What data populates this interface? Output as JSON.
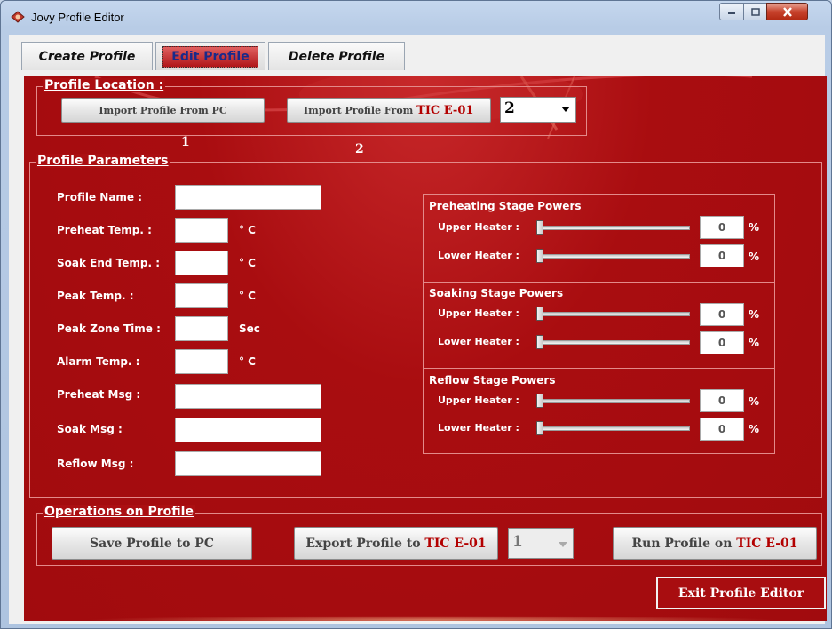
{
  "window": {
    "title": "Jovy Profile Editor"
  },
  "tabs": [
    {
      "label": "Create Profile"
    },
    {
      "label": "Edit Profile",
      "selected": true
    },
    {
      "label": "Delete Profile"
    }
  ],
  "profile_location": {
    "title": "Profile Location :",
    "import_pc_label": "Import Profile From PC",
    "import_tic_prefix": "Import Profile From ",
    "device_name": "TIC E-01",
    "slot_value": "2",
    "marker_1": "1",
    "marker_2": "2"
  },
  "profile_parameters": {
    "title": "Profile Parameters",
    "fields": [
      {
        "label": "Profile Name :",
        "value": "",
        "unit": ""
      },
      {
        "label": "Preheat Temp. :",
        "value": "",
        "unit": "° C"
      },
      {
        "label": "Soak End Temp. :",
        "value": "",
        "unit": "° C"
      },
      {
        "label": "Peak Temp. :",
        "value": "",
        "unit": "° C"
      },
      {
        "label": "Peak Zone Time :",
        "value": "",
        "unit": "Sec"
      },
      {
        "label": "Alarm Temp. :",
        "value": "",
        "unit": "° C"
      },
      {
        "label": "Preheat Msg :",
        "value": "",
        "unit": ""
      },
      {
        "label": "Soak Msg :",
        "value": "",
        "unit": ""
      },
      {
        "label": "Reflow Msg :",
        "value": "",
        "unit": ""
      }
    ]
  },
  "stages": [
    {
      "title": "Preheating Stage Powers",
      "upper_label": "Upper Heater :",
      "upper_value": "0",
      "lower_label": "Lower Heater :",
      "lower_value": "0",
      "unit": "%"
    },
    {
      "title": "Soaking Stage Powers",
      "upper_label": "Upper Heater :",
      "upper_value": "0",
      "lower_label": "Lower Heater :",
      "lower_value": "0",
      "unit": "%"
    },
    {
      "title": "Reflow Stage Powers",
      "upper_label": "Upper Heater :",
      "upper_value": "0",
      "lower_label": "Lower Heater :",
      "lower_value": "0",
      "unit": "%"
    }
  ],
  "operations": {
    "title": "Operations on Profile",
    "save_label": "Save Profile to PC",
    "export_prefix": "Export Profile to ",
    "device_name": "TIC E-01",
    "slot_value": "1",
    "run_prefix": "Run Profile on ",
    "exit_label": "Exit Profile Editor"
  },
  "colors": {
    "panel_red": "#a90d10",
    "accent_text_red": "#b30000",
    "title_blue": "#1a2a8a"
  }
}
